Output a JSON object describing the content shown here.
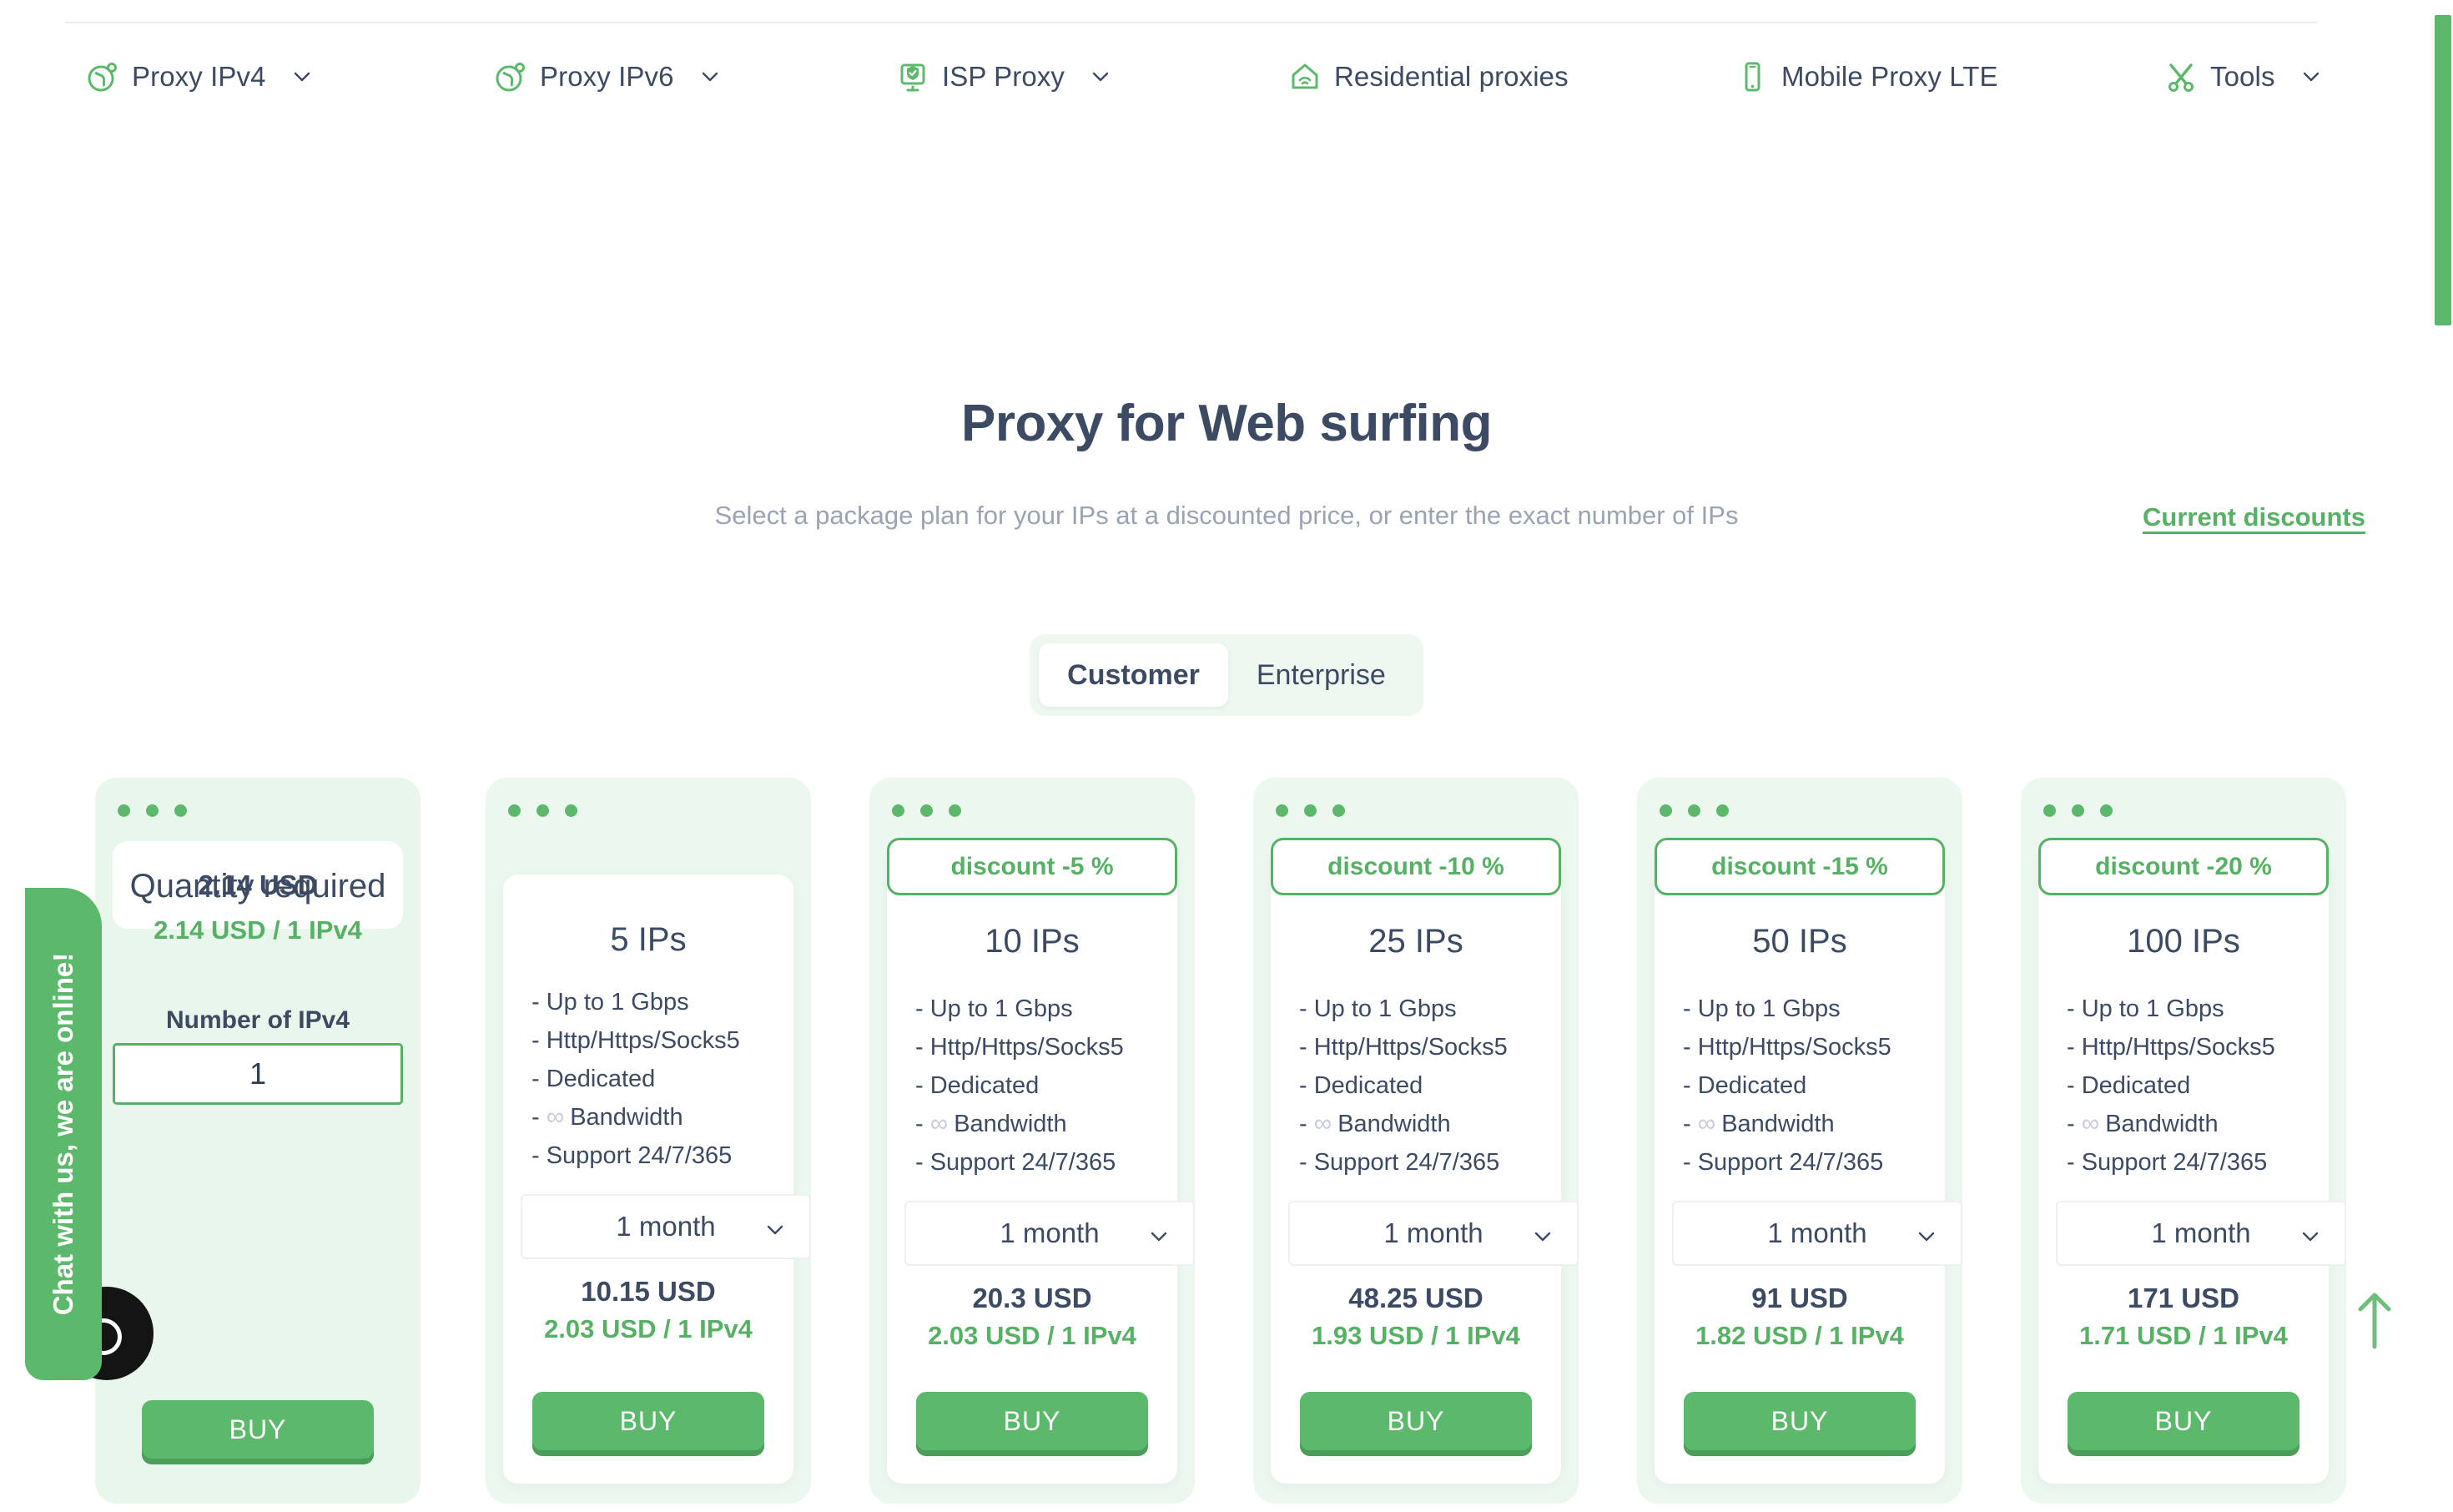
{
  "nav": {
    "items": [
      {
        "label": "Proxy IPv4",
        "icon": "globe-person-icon",
        "has_chevron": true
      },
      {
        "label": "Proxy IPv6",
        "icon": "globe-person-icon",
        "has_chevron": true
      },
      {
        "label": "ISP Proxy",
        "icon": "shield-monitor-icon",
        "has_chevron": true
      },
      {
        "label": "Residential proxies",
        "icon": "house-wifi-icon",
        "has_chevron": false
      },
      {
        "label": "Mobile Proxy LTE",
        "icon": "mobile-phone-icon",
        "has_chevron": false
      },
      {
        "label": "Tools",
        "icon": "tools-icon",
        "has_chevron": true
      }
    ]
  },
  "hero": {
    "title": "Proxy for Web surfing",
    "subtitle": "Select a package plan for your IPs at a discounted price, or enter the exact number of IPs",
    "discounts_link": "Current discounts"
  },
  "tabs": {
    "items": [
      "Customer",
      "Enterprise"
    ],
    "active": "Customer"
  },
  "quantity_card": {
    "title": "Quantity required",
    "field_label": "Number of IPv4",
    "value": "1",
    "placeholder": "1",
    "price_total": "2.14 USD",
    "price_unit": "2.14 USD / 1 IPv4",
    "buy_label": "BUY"
  },
  "features": {
    "bandwidth_symbol": "∞",
    "lines": [
      "- Up to 1 Gbps",
      "- Http/Https/Socks5",
      "- Dedicated",
      "- Support 24/7/365"
    ],
    "bandwidth_label": "Bandwidth",
    "dash": "-"
  },
  "plans": [
    {
      "title": "5 IPs",
      "badge": null,
      "period": "1 month",
      "price_total": "10.15 USD",
      "price_unit": "2.03 USD / 1 IPv4",
      "buy_label": "BUY"
    },
    {
      "title": "10 IPs",
      "badge": "discount -5 %",
      "period": "1 month",
      "price_total": "20.3 USD",
      "price_unit": "2.03 USD / 1 IPv4",
      "buy_label": "BUY"
    },
    {
      "title": "25 IPs",
      "badge": "discount -10 %",
      "period": "1 month",
      "price_total": "48.25 USD",
      "price_unit": "1.93 USD / 1 IPv4",
      "buy_label": "BUY"
    },
    {
      "title": "50 IPs",
      "badge": "discount -15 %",
      "period": "1 month",
      "price_total": "91 USD",
      "price_unit": "1.82 USD / 1 IPv4",
      "buy_label": "BUY"
    },
    {
      "title": "100 IPs",
      "badge": "discount -20 %",
      "period": "1 month",
      "price_total": "171 USD",
      "price_unit": "1.71 USD / 1 IPv4",
      "buy_label": "BUY"
    }
  ],
  "chat": {
    "label": "Chat with us, we are online!"
  },
  "colors": {
    "accent_green": "#5cb96c",
    "link_green": "#57b165",
    "text_dark": "#3d4a63",
    "muted": "#9aa3b4",
    "card_bg": "#e9f6ec"
  }
}
